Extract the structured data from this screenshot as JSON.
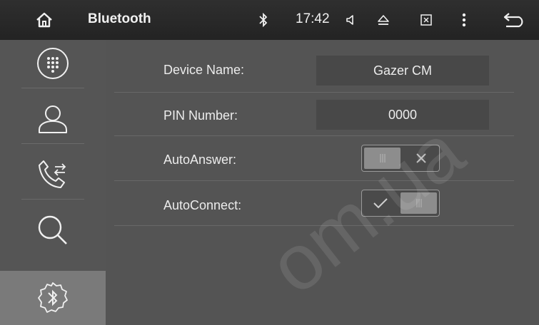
{
  "topbar": {
    "title": "Bluetooth",
    "time": "17:42",
    "icons": [
      "home-icon",
      "bluetooth-status-icon",
      "volume-icon",
      "eject-icon",
      "close-window-icon",
      "more-icon",
      "back-icon"
    ]
  },
  "sidebar": {
    "items": [
      {
        "name": "dialpad",
        "icon": "dialpad-icon"
      },
      {
        "name": "contacts",
        "icon": "contacts-icon"
      },
      {
        "name": "call-log",
        "icon": "call-log-icon"
      },
      {
        "name": "search",
        "icon": "search-icon"
      },
      {
        "name": "bluetooth-settings",
        "icon": "bluetooth-settings-icon",
        "active": true
      }
    ]
  },
  "settings": {
    "device_name_label": "Device Name:",
    "device_name_value": "Gazer CM",
    "pin_label": "PIN Number:",
    "pin_value": "0000",
    "auto_answer_label": "AutoAnswer:",
    "auto_answer_state": "off",
    "auto_connect_label": "AutoConnect:",
    "auto_connect_state": "on"
  },
  "watermark": "om.ua",
  "colors": {
    "topbar": "#2a2a2a",
    "sidebar": "#555555",
    "main": "#545454",
    "active_item": "#7a7a7a",
    "text": "#ececec"
  }
}
